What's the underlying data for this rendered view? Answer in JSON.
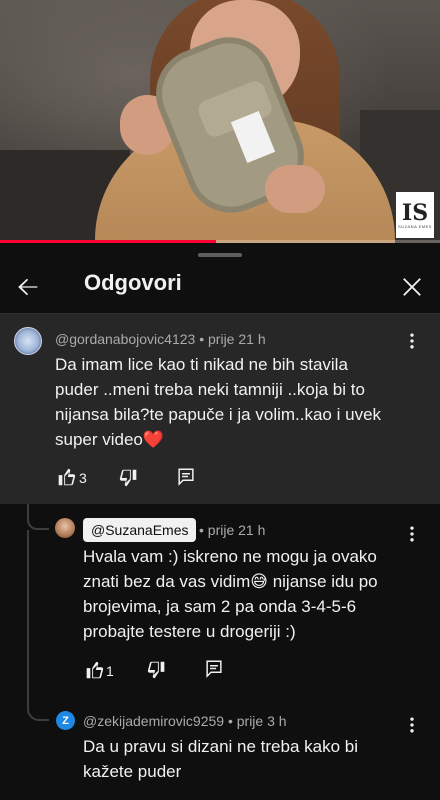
{
  "video": {
    "channel_logo_text": "IS",
    "channel_logo_sub": "SUZANA EMES",
    "progress_fraction": 0.49
  },
  "panel": {
    "title": "Odgovori"
  },
  "top_comment": {
    "author": "@gordanabojovic4123",
    "time": "prije 21 h",
    "lines": [
      "Da imam lice kao ti nikad ne bih stavila",
      "puder ..meni treba neki tamniji ..koja bi to",
      "nijansa bila?te papuče i ja volim..kao i uvek",
      "super video❤️"
    ],
    "likes": "3"
  },
  "reply_1": {
    "author": "@SuzanaEmes",
    "time": "prije 21 h",
    "lines": [
      "Hvala vam :) iskreno ne mogu ja ovako",
      "znati bez da vas vidim😅 nijanse idu po",
      "brojevima, ja sam 2 pa onda 3-4-5-6",
      "probajte testere u drogeriji :)"
    ],
    "likes": "1"
  },
  "reply_2": {
    "author": "@zekijademirovic9259",
    "avatar_letter": "Z",
    "time": "prije 3 h",
    "lines": [
      "Da u pravu si dizani ne treba kako bi",
      "kažete puder"
    ]
  },
  "colors": {
    "background": "#0f0f0f",
    "highlight_comment_bg": "#272727",
    "progress": "#ff0033",
    "avatar_z": "#1e88e5"
  },
  "icons": [
    "back-arrow-icon",
    "close-icon",
    "more-vert-icon",
    "thumb-up-icon",
    "thumb-down-icon",
    "reply-icon"
  ]
}
